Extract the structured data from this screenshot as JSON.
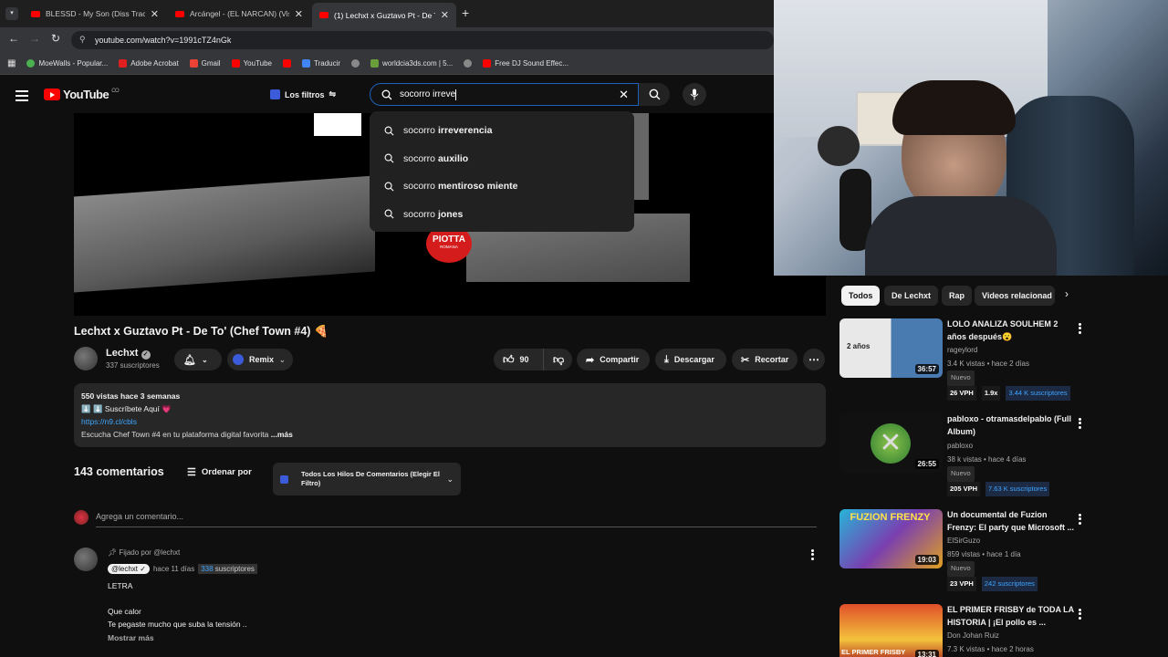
{
  "browser": {
    "tabs": [
      {
        "title": "BLESSD - My Son (Diss Track fo",
        "active": false
      },
      {
        "title": "Arcángel - (EL NARCAN) (Visua",
        "active": false
      },
      {
        "title": "(1) Lechxt x Guztavo Pt - De To",
        "active": true
      }
    ],
    "url": "youtube.com/watch?v=1991cTZ4nGk",
    "bookmarks": [
      "MoeWalls - Popular...",
      "Adobe Acrobat",
      "Gmail",
      "YouTube",
      "",
      "Traducir",
      "",
      "worldcia3ds.com | 5...",
      "",
      "Free DJ Sound Effec..."
    ]
  },
  "header": {
    "logo": "YouTube",
    "country": "CO",
    "filters_label": "Los filtros",
    "search_value": "socorro irreve"
  },
  "suggestions": [
    {
      "prefix": "socorro ",
      "bold": "irreverencia"
    },
    {
      "prefix": "socorro ",
      "bold": "auxilio"
    },
    {
      "prefix": "socorro ",
      "bold": "mentiroso miente"
    },
    {
      "prefix": "socorro ",
      "bold": "jones"
    }
  ],
  "video": {
    "overlay_logo": "PIOTTA",
    "overlay_sub": "ROMANA",
    "title": "Lechxt x Guztavo Pt - De To' (Chef Town #4) 🍕",
    "channel": "Lechxt",
    "subscribers": "337 suscriptores",
    "remix_label": "Remix",
    "likes": "90",
    "share_label": "Compartir",
    "download_label": "Descargar",
    "clip_label": "Recortar"
  },
  "description": {
    "stats": "550 vistas  hace 3 semanas",
    "line1": "⬇️ ⬇️ Suscríbete Aquí 💗",
    "link": "https://n9.cl/cbls",
    "line3": "Escucha Chef Town #4 en tu plataforma digital favorita",
    "more": "...más"
  },
  "comments": {
    "count": "143 comentarios",
    "sort_label": "Ordenar por",
    "filter_label": "Todos Los Hilos De Comentarios (Elegir El Filtro)",
    "add_placeholder": "Agrega un comentario...",
    "pinned_label": "Fijado por @lechxt",
    "author": "@lechxt",
    "time": "hace 11 días",
    "author_subs": "338",
    "author_subs_label": "suscriptores",
    "body_line1": "LETRA",
    "body_line2": "Que calor",
    "body_line3": "Te pegaste mucho que suba la tensión ..",
    "show_more": "Mostrar más"
  },
  "sidebar": {
    "chips": [
      "Todos",
      "De Lechxt",
      "Rap",
      "Videos relacionad"
    ],
    "videos": [
      {
        "title": "LOLO ANALIZA SOULHEM 2 años después😮",
        "channel": "rageylord",
        "views": "3.4 K vistas • hace 2 días",
        "badge": "Nuevo",
        "duration": "36:57",
        "vph": "26 VPH",
        "ratio": "1.9x",
        "subs": "3.44 K suscriptores",
        "thumb_text": "2 años"
      },
      {
        "title": "pabloxo - otramasdelpablo (Full Album)",
        "channel": "pabloxo",
        "views": "38 k vistas • hace 4 días",
        "badge": "Nuevo",
        "duration": "26:55",
        "vph": "205 VPH",
        "ratio": "",
        "subs": "7.63 K suscriptores",
        "thumb_text": ""
      },
      {
        "title": "Un documental de Fuzion Frenzy: El party que Microsoft ...",
        "channel": "ElSirGuzo",
        "views": "859 vistas • hace 1 día",
        "badge": "Nuevo",
        "duration": "19:03",
        "vph": "23 VPH",
        "ratio": "",
        "subs": "242 suscriptores",
        "thumb_text": "FUZION FRENZY"
      },
      {
        "title": "EL PRIMER FRISBY de TODA LA HISTORIA | ¡El pollo es ...",
        "channel": "Don Johan Ruiz",
        "views": "7.3 K vistas • hace 2 horas",
        "badge": "",
        "duration": "13:31",
        "vph": "",
        "ratio": "",
        "subs": "",
        "thumb_text": "EL PRIMER FRISBY"
      }
    ]
  }
}
